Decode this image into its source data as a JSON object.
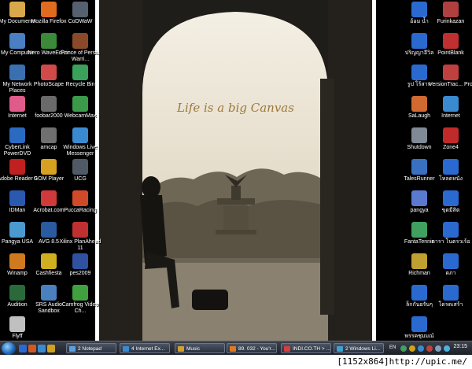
{
  "wallpaper": {
    "text": "Life is a big Canvas"
  },
  "desktop_left": [
    {
      "label": "My Documents",
      "icon": "folder-icon",
      "color": "#d9a84a"
    },
    {
      "label": "Mozilla Firefox",
      "icon": "firefox-icon",
      "color": "#e06a1f"
    },
    {
      "label": "CoDWaW",
      "icon": "game-icon",
      "color": "#556070"
    },
    {
      "label": "My Computer",
      "icon": "computer-icon",
      "color": "#4a7fc4"
    },
    {
      "label": "Nero WaveEditor",
      "icon": "nero-icon",
      "color": "#3a8a3a"
    },
    {
      "label": "Prince of Persia Warri...",
      "icon": "game-icon",
      "color": "#8a4a2a"
    },
    {
      "label": "My Network Places",
      "icon": "network-icon",
      "color": "#3a6fb0"
    },
    {
      "label": "PhotoScape",
      "icon": "photoscape-icon",
      "color": "#d04a4a"
    },
    {
      "label": "Recycle Bin",
      "icon": "recycle-bin-icon",
      "color": "#3aa05a"
    },
    {
      "label": "Internet",
      "icon": "hello-kitty-icon",
      "color": "#e05a8a"
    },
    {
      "label": "foobar2000",
      "icon": "foobar-icon",
      "color": "#6a6a6a"
    },
    {
      "label": "WebcamMax",
      "icon": "webcam-icon",
      "color": "#3a9a4a"
    },
    {
      "label": "CyberLink PowerDVD",
      "icon": "dvd-icon",
      "color": "#2a6ac0"
    },
    {
      "label": "amcap",
      "icon": "camera-icon",
      "color": "#707070"
    },
    {
      "label": "Windows Live Messenger",
      "icon": "messenger-icon",
      "color": "#3a8ad0"
    },
    {
      "label": "Adobe Reader 9",
      "icon": "pdf-icon",
      "color": "#c02020"
    },
    {
      "label": "GOM Player",
      "icon": "gom-player-icon",
      "color": "#d8a020"
    },
    {
      "label": "UCG",
      "icon": "ucg-icon",
      "color": "#505a66"
    },
    {
      "label": "IDMan",
      "icon": "download-icon",
      "color": "#2a5ab0"
    },
    {
      "label": "Acrobat.com",
      "icon": "acrobat-icon",
      "color": "#d03a3a"
    },
    {
      "label": "PuccaRacing",
      "icon": "racing-icon",
      "color": "#d04a2a"
    },
    {
      "label": "Pangya USA",
      "icon": "pangya-icon",
      "color": "#4a9ad0"
    },
    {
      "label": "AVG 8.5",
      "icon": "antivirus-icon",
      "color": "#2a5aa0"
    },
    {
      "label": "Xilinx PlanAhead 11",
      "icon": "xilinx-icon",
      "color": "#c03030"
    },
    {
      "label": "Winamp",
      "icon": "winamp-icon",
      "color": "#d07a20"
    },
    {
      "label": "Cashfiesta",
      "icon": "cash-icon",
      "color": "#d0b020"
    },
    {
      "label": "pes2009",
      "icon": "soccer-icon",
      "color": "#3050a0"
    },
    {
      "label": "Audition",
      "icon": "audition-icon",
      "color": "#2a6a3a"
    },
    {
      "label": "SRS Audio Sandbox",
      "icon": "audio-icon",
      "color": "#4a80c0"
    },
    {
      "label": "Camfrog Video Ch...",
      "icon": "camfrog-icon",
      "color": "#40a040"
    },
    {
      "label": "Flyff",
      "icon": "flyff-icon",
      "color": "#c0c0c0"
    }
  ],
  "desktop_right": [
    {
      "label": "อ้อม น้ำ",
      "icon": "folder-icon",
      "color": "#2a6ad0"
    },
    {
      "label": "Furinkazan",
      "icon": "game-icon",
      "color": "#b04040"
    },
    {
      "label": "ปริญญาอีวิล",
      "icon": "folder-icon",
      "color": "#2a6ad0"
    },
    {
      "label": "PointBlank",
      "icon": "game-icon",
      "color": "#c03030"
    },
    {
      "label": "รูป โร้สาห",
      "icon": "folder-icon",
      "color": "#2a6ad0"
    },
    {
      "label": "VersionTrac... Pro",
      "icon": "version-icon",
      "color": "#c04040"
    },
    {
      "label": "SaLaugh",
      "icon": "salaugh-icon",
      "color": "#d06a30"
    },
    {
      "label": "Internet",
      "icon": "internet-explorer-icon",
      "color": "#3a8ad0"
    },
    {
      "label": "Shutdown",
      "icon": "shutdown-icon",
      "color": "#808a96"
    },
    {
      "label": "Zone4",
      "icon": "zone4-icon",
      "color": "#c02a2a"
    },
    {
      "label": "TalesRunner",
      "icon": "talesrunner-icon",
      "color": "#3a70c0"
    },
    {
      "label": "โหลดหนัง",
      "icon": "folder-icon",
      "color": "#2a6ad0"
    },
    {
      "label": "pangya",
      "icon": "pangya-icon",
      "color": "#5a7ad0"
    },
    {
      "label": "ขุดมีสิต",
      "icon": "folder-icon",
      "color": "#2a6ad0"
    },
    {
      "label": "FantaTennis",
      "icon": "tennis-icon",
      "color": "#40a060"
    },
    {
      "label": "ดารา โนตรวเร้อ",
      "icon": "folder-icon",
      "color": "#2a6ad0"
    },
    {
      "label": "Richman",
      "icon": "richman-icon",
      "color": "#c0a030"
    },
    {
      "label": "ดภา",
      "icon": "folder-icon",
      "color": "#2a6ad0"
    },
    {
      "label": "ล็กกันยรันๆ",
      "icon": "folder-icon",
      "color": "#2a6ad0"
    },
    {
      "label": "โดรดเสร้า",
      "icon": "folder-icon",
      "color": "#2a6ad0"
    },
    {
      "label": "พรรคชุมมณ์",
      "icon": "file-icon",
      "color": "#2a6ad0"
    }
  ],
  "taskbar": {
    "tasks": [
      {
        "label": "2 Notepad",
        "color": "#5aa0e0"
      },
      {
        "label": "4 Internet Ex...",
        "color": "#3a8ad0"
      },
      {
        "label": "Music",
        "color": "#d0a030"
      },
      {
        "label": "89. 032 - You'r...",
        "color": "#e07a20"
      },
      {
        "label": "INDI.CO.TH > ...",
        "color": "#d04040"
      },
      {
        "label": "2 Windows Li...",
        "color": "#40a0d0"
      }
    ],
    "lang": "EN",
    "clock": "23:15"
  },
  "caption": "[1152x864]http://upic.me/"
}
